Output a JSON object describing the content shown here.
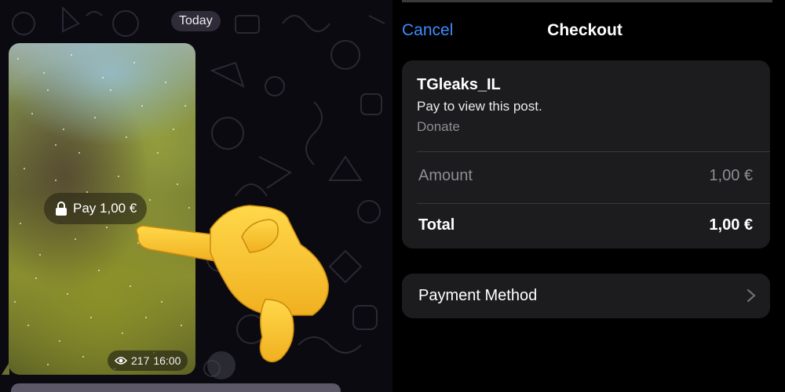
{
  "chat": {
    "date_label": "Today",
    "media": {
      "pay_label": "Pay 1,00 €",
      "lock_icon": "lock-icon",
      "views": "217",
      "time": "16:00",
      "eye_icon": "eye-icon"
    }
  },
  "checkout": {
    "cancel_label": "Cancel",
    "title": "Checkout",
    "merchant": "TGleaks_IL",
    "description": "Pay to view this post.",
    "type": "Donate",
    "amount_label": "Amount",
    "amount_value": "1,00 €",
    "total_label": "Total",
    "total_value": "1,00 €",
    "payment_method_label": "Payment Method",
    "chevron_icon": "chevron-right-icon"
  },
  "colors": {
    "accent": "#3d8bfd",
    "card_bg": "#1c1c1e",
    "muted_text": "#8d8d93"
  }
}
